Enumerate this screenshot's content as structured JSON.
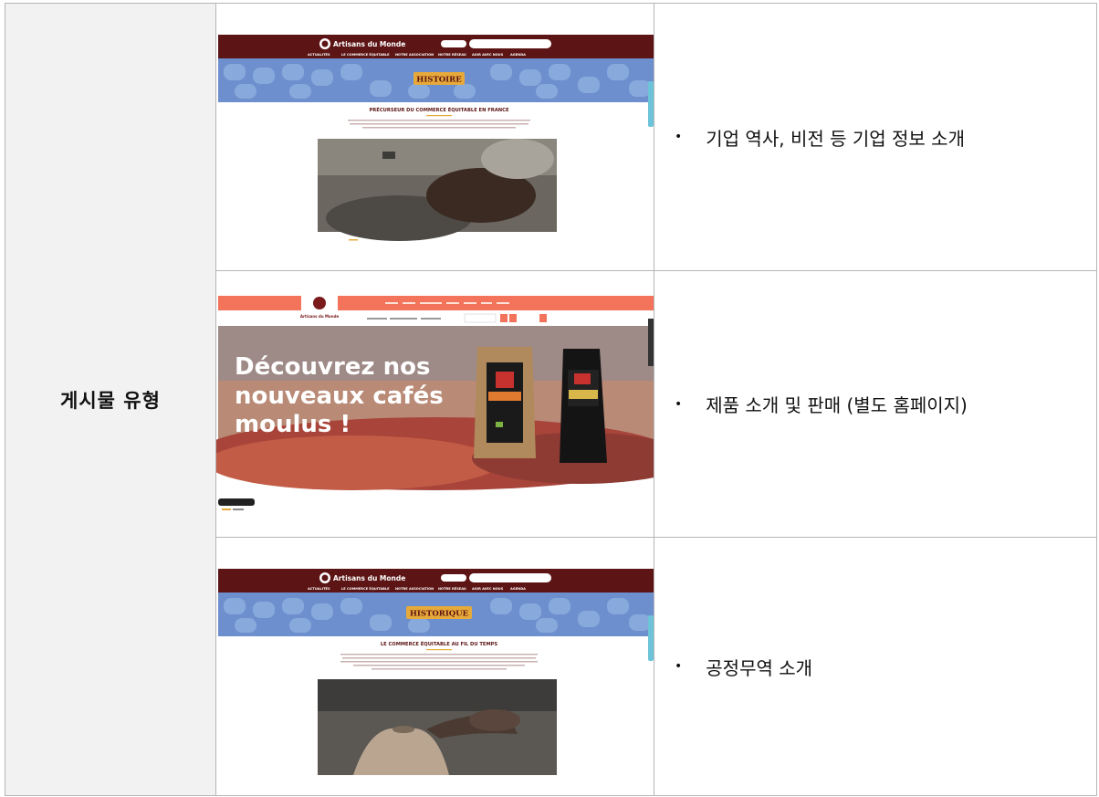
{
  "row_label": "게시물 유형",
  "bullet": "•",
  "rows": [
    {
      "description": "기업 역사, 비전 등 기업 정보 소개",
      "screenshot": {
        "brand": "Artisans du Monde",
        "banner_title": "HISTOIRE",
        "heading": "PRÉCURSEUR DU COMMERCE ÉQUITABLE EN FRANCE",
        "nav": [
          "ACTUALITÉS",
          "LE COMMERCE ÉQUITABLE",
          "NOTRE ASSOCIATION",
          "NOTRE RÉSEAU",
          "AGIR AVEC NOUS",
          "AGENDA"
        ]
      }
    },
    {
      "description": "제품 소개 및 판매 (별도 홈페이지)",
      "screenshot": {
        "brand": "Artisans du Monde",
        "hero_line1": "Découvrez nos",
        "hero_line2": "nouveaux cafés",
        "hero_line3": "moulus !"
      }
    },
    {
      "description": "공정무역 소개",
      "screenshot": {
        "brand": "Artisans du Monde",
        "banner_title": "HISTORIQUE",
        "heading": "LE COMMERCE ÉQUITABLE AU FIL DU TEMPS",
        "nav": [
          "ACTUALITÉS",
          "LE COMMERCE ÉQUITABLE",
          "NOTRE ASSOCIATION",
          "NOTRE RÉSEAU",
          "AGIR AVEC NOUS",
          "AGENDA"
        ]
      }
    }
  ],
  "colors": {
    "header_maroon": "#5c1414",
    "banner_blue": "#6e8fce",
    "banner_gold": "#e6a93a",
    "coral": "#f4735b",
    "cell_gray": "#f2f2f2"
  }
}
